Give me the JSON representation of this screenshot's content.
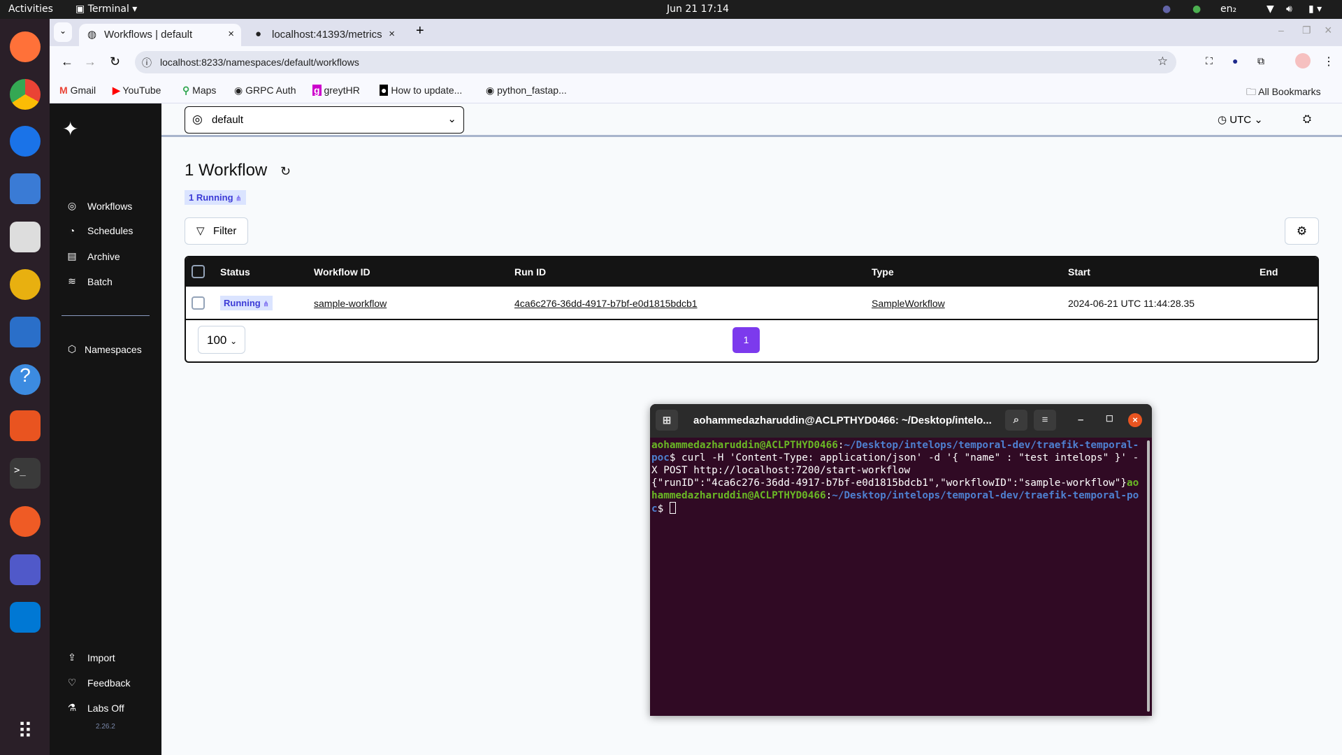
{
  "os": {
    "activities": "Activities",
    "app": "Terminal",
    "datetime": "Jun 21  17:14",
    "lang": "en₂"
  },
  "browser": {
    "tabs": [
      {
        "label": "Workflows | default",
        "active": true
      },
      {
        "label": "localhost:41393/metrics",
        "active": false
      }
    ],
    "url": "localhost:8233/namespaces/default/workflows",
    "bookmarks": [
      "Gmail",
      "YouTube",
      "Maps",
      "GRPC Auth",
      "greytHR",
      "How to update...",
      "python_fastap..."
    ],
    "all_bookmarks": "All Bookmarks"
  },
  "sidebar": {
    "items": [
      {
        "label": "Workflows",
        "icon": "workflows-icon"
      },
      {
        "label": "Schedules",
        "icon": "schedules-icon"
      },
      {
        "label": "Archive",
        "icon": "archive-icon"
      },
      {
        "label": "Batch",
        "icon": "batch-icon"
      }
    ],
    "namespaces": "Namespaces",
    "bottom": [
      {
        "label": "Import"
      },
      {
        "label": "Feedback"
      },
      {
        "label": "Labs Off"
      }
    ],
    "version": "2.26.2"
  },
  "header": {
    "namespace": "default",
    "timezone": "UTC"
  },
  "main": {
    "title": "1 Workflow",
    "badge": "1 Running",
    "filter_label": "Filter",
    "columns": [
      "Status",
      "Workflow ID",
      "Run ID",
      "Type",
      "Start",
      "End"
    ],
    "rows": [
      {
        "status": "Running",
        "workflow_id": "sample-workflow",
        "run_id": "4ca6c276-36dd-4917-b7bf-e0d1815bdcb1",
        "type": "SampleWorkflow",
        "start": "2024-06-21 UTC 11:44:28.35",
        "end": ""
      }
    ],
    "page_size": "100",
    "page": "1",
    "accent": "#7c3aed"
  },
  "terminal": {
    "title": "aohammedazharuddin@ACLPTHYD0466: ~/Desktop/intelo...",
    "user": "aohammedazharuddin@ACLPTHYD0466",
    "path": "~/Desktop/intelops/temporal-dev/traefik-temporal-poc",
    "command": "curl -H 'Content-Type: application/json' -d '{ \"name\" : \"test intelops\" }' -X POST http://localhost:7200/start-workflow",
    "output": "{\"runID\":\"4ca6c276-36dd-4917-b7bf-e0d1815bdcb1\",\"workflowID\":\"sample-workflow\"}"
  }
}
